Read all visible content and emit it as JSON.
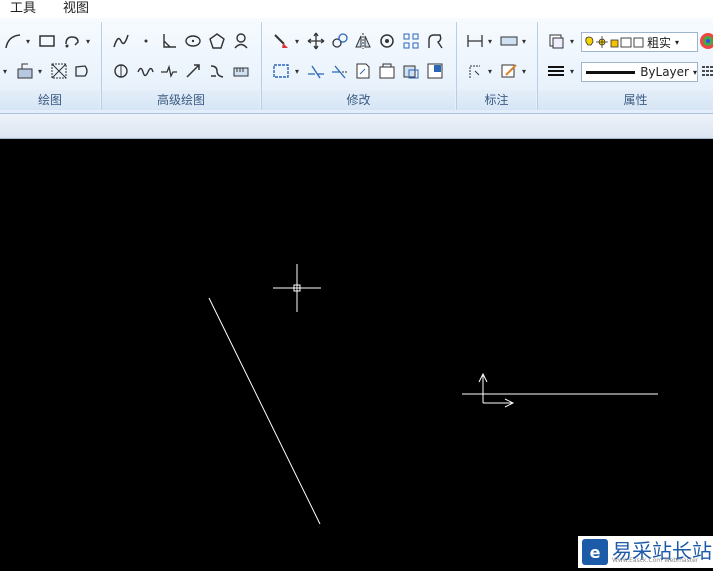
{
  "menu": {
    "tools": "工具",
    "view": "视图"
  },
  "panels": {
    "draw": "绘图",
    "advanced_draw": "高级绘图",
    "modify": "修改",
    "dimension": "标注",
    "properties": "属性"
  },
  "properties": {
    "lineweight_value": "粗实",
    "linetype_value": "ByLayer"
  },
  "icons": [
    "arc-icon",
    "rectangle-icon",
    "revision-cloud-icon",
    "spline-icon",
    "point-icon",
    "angle-icon",
    "ellipse-icon",
    "polygon-icon",
    "user-shape-icon",
    "hatch-icon",
    "table-icon",
    "boundary-icon",
    "region-icon",
    "wave-icon",
    "break-line-icon",
    "arrow-icon",
    "fillet-icon",
    "ruler-icon",
    "paint-icon",
    "move-icon",
    "copy-icon",
    "mirror-icon",
    "rotate-icon",
    "array-icon",
    "stretch-icon",
    "offset-icon",
    "trim-icon",
    "extend-icon",
    "explode-icon",
    "layer-state-icon",
    "lightbulb-icon",
    "sun-icon",
    "lock-icon",
    "print-icon",
    "color-square-icon"
  ],
  "watermark": {
    "text": "易采站长站",
    "subtext": "Www.Easck.Com  Webmaster"
  },
  "colors": {
    "canvas": "#000000",
    "drawing_lines": "#ffffff",
    "ribbon": "#e3eefa",
    "panel_title": "#3b5b82",
    "brand": "#1d5aa8"
  }
}
